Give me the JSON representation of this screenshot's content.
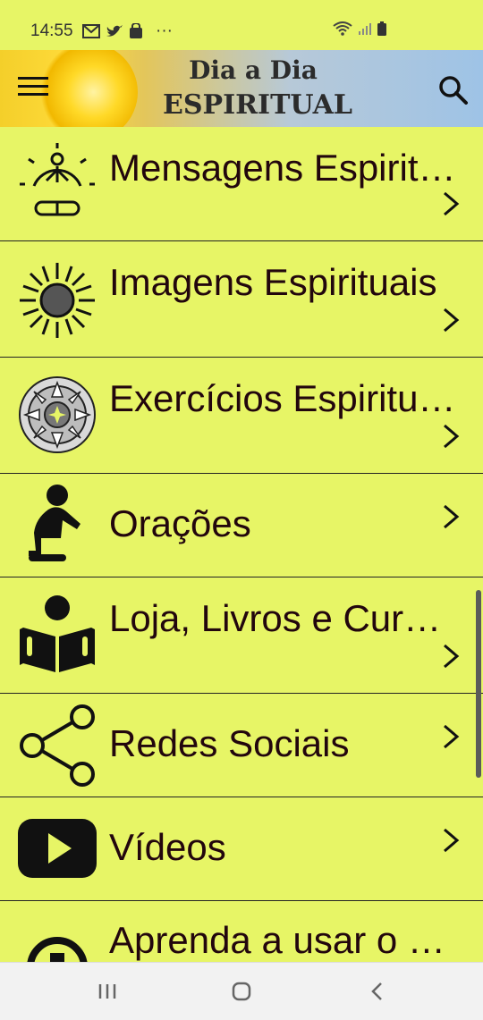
{
  "status_bar": {
    "time": "14:55",
    "more": "···"
  },
  "header": {
    "title_line1": "Dia a Dia",
    "title_line2": "ESPIRITUAL",
    "menu_icon": "hamburger-icon",
    "search_icon": "search-icon"
  },
  "menu": {
    "items": [
      {
        "label": "Mensagens Espiritu…",
        "icon": "meditation-icon"
      },
      {
        "label": "Imagens Espirituais",
        "icon": "sun-icon"
      },
      {
        "label": "Exercícios Espiritu…",
        "icon": "mandala-icon"
      },
      {
        "label": "Orações",
        "icon": "praying-person-icon"
      },
      {
        "label": "Loja, Livros e Curs…",
        "icon": "reader-book-icon"
      },
      {
        "label": "Redes Sociais",
        "icon": "share-icon"
      },
      {
        "label": "Vídeos",
        "icon": "play-video-icon"
      },
      {
        "label": "Aprenda a usar o …",
        "icon": "help-icon"
      }
    ]
  },
  "colors": {
    "background": "#e7f566",
    "text": "#22060d",
    "divider": "#222222"
  }
}
